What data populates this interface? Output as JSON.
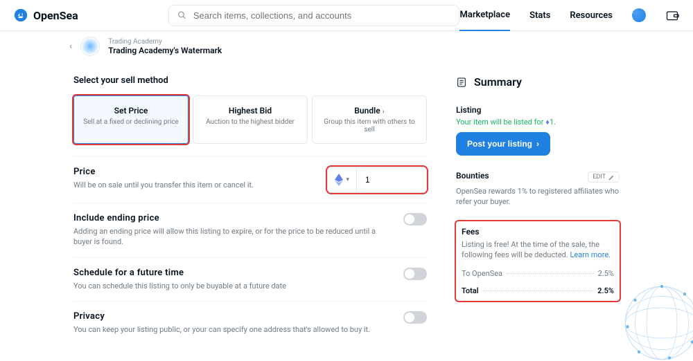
{
  "header": {
    "logo_text": "OpenSea",
    "search_placeholder": "Search items, collections, and accounts",
    "nav": {
      "marketplace": "Marketplace",
      "stats": "Stats",
      "resources": "Resources"
    }
  },
  "breadcrumb": {
    "collection": "Trading Academy",
    "item": "Trading Academy's Watermark"
  },
  "sell": {
    "method_label": "Select your sell method",
    "methods": {
      "set_price": {
        "title": "Set Price",
        "sub": "Sell at a fixed or declining price"
      },
      "highest_bid": {
        "title": "Highest Bid",
        "sub": "Auction to the highest bidder"
      },
      "bundle": {
        "title": "Bundle",
        "sub": "Group this item with others to sell"
      }
    },
    "price": {
      "title": "Price",
      "sub": "Will be on sale until you transfer this item or cancel it.",
      "value": "1"
    },
    "ending": {
      "title": "Include ending price",
      "sub": "Adding an ending price will allow this listing to expire, or for the price to be reduced until a buyer is found."
    },
    "schedule": {
      "title": "Schedule for a future time",
      "sub": "You can schedule this listing to only be buyable at a future date"
    },
    "privacy": {
      "title": "Privacy",
      "sub": "You can keep your listing public, or your can specify one address that's allowed to buy it."
    }
  },
  "summary": {
    "title": "Summary",
    "listing_label": "Listing",
    "listing_text": "Your item will be listed for ",
    "listing_price": "1",
    "post_btn": "Post your listing",
    "bounties": {
      "label": "Bounties",
      "edit": "EDIT",
      "text": "OpenSea rewards 1% to registered affiliates who refer your buyer."
    },
    "fees": {
      "label": "Fees",
      "text": "Listing is free! At the time of the sale, the following fees will be deducted. ",
      "learn": "Learn more.",
      "opensea_label": "To OpenSea",
      "opensea_value": "2.5%",
      "total_label": "Total",
      "total_value": "2.5%"
    }
  }
}
